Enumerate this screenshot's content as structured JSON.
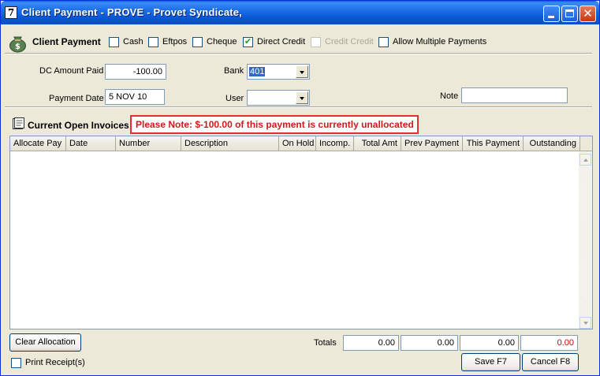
{
  "window": {
    "title": "Client Payment - PROVE - Provet Syndicate,",
    "icon_glyph": "7"
  },
  "payment_type": {
    "heading": "Client Payment",
    "options": [
      {
        "label": "Cash",
        "checked": false,
        "enabled": true
      },
      {
        "label": "Eftpos",
        "checked": false,
        "enabled": true
      },
      {
        "label": "Cheque",
        "checked": false,
        "enabled": true
      },
      {
        "label": "Direct Credit",
        "checked": true,
        "enabled": true
      },
      {
        "label": "Credit Credit",
        "checked": false,
        "enabled": false
      },
      {
        "label": "Allow Multiple Payments",
        "checked": false,
        "enabled": true
      }
    ]
  },
  "form": {
    "amount_label": "DC Amount Paid",
    "amount_value": "-100.00",
    "bank_label": "Bank",
    "bank_value": "401",
    "date_label": "Payment Date",
    "date_value": "5 NOV 10",
    "user_label": "User",
    "user_value": "",
    "note_label": "Note",
    "note_value": ""
  },
  "invoices": {
    "heading": "Current Open Invoices",
    "notice": "Please Note: $-100.00 of this payment is currently unallocated",
    "columns": [
      "Allocate Pay",
      "Date",
      "Number",
      "Description",
      "On Hold",
      "Incomp.",
      "Total Amt",
      "Prev Payment",
      "This Payment",
      "Outstanding"
    ]
  },
  "footer": {
    "clear_allocation": "Clear Allocation",
    "totals_label": "Totals",
    "totals": [
      "0.00",
      "0.00",
      "0.00",
      "0.00"
    ],
    "print_receipt": "Print Receipt(s)",
    "save": "Save F7",
    "cancel": "Cancel F8"
  },
  "colors": {
    "notice_text": "#d01a1a",
    "outstanding_total": "#cc0000",
    "checkmark": "#21a121"
  },
  "icons": {
    "payment": "money-bag-icon",
    "invoices": "invoice-icon",
    "minimize": "minimize-icon",
    "maximize": "maximize-icon",
    "close": "close-icon"
  }
}
